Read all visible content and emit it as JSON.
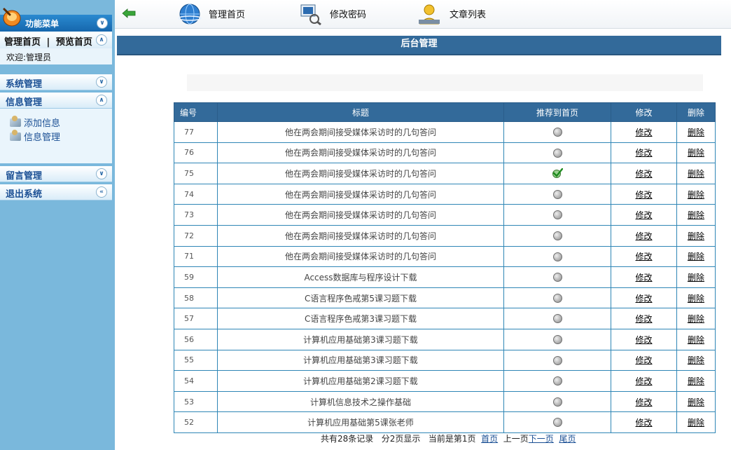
{
  "sidebar": {
    "title": "功能菜单",
    "links": {
      "home": "管理首页",
      "separator": "|",
      "preview": "预览首页"
    },
    "welcome": "欢迎:管理员",
    "sections": [
      {
        "label": "系统管理",
        "state": "collapsed"
      },
      {
        "label": "信息管理",
        "state": "expanded",
        "items": [
          "添加信息",
          "信息管理"
        ]
      },
      {
        "label": "留言管理",
        "state": "collapsed"
      },
      {
        "label": "退出系统",
        "state": "collapsed"
      }
    ]
  },
  "toolbar": {
    "items": [
      "管理首页",
      "修改密码",
      "文章列表"
    ]
  },
  "header": {
    "title": "后台管理"
  },
  "table": {
    "columns": [
      "编号",
      "标题",
      "推荐到首页",
      "修改",
      "删除"
    ],
    "edit_label": "修改",
    "delete_label": "删除",
    "rows": [
      {
        "id": "77",
        "title": "他在两会期间接受媒体采访时的几句答问",
        "recommended": false
      },
      {
        "id": "76",
        "title": "他在两会期间接受媒体采访时的几句答问",
        "recommended": false
      },
      {
        "id": "75",
        "title": "他在两会期间接受媒体采访时的几句答问",
        "recommended": true
      },
      {
        "id": "74",
        "title": "他在两会期间接受媒体采访时的几句答问",
        "recommended": false
      },
      {
        "id": "73",
        "title": "他在两会期间接受媒体采访时的几句答问",
        "recommended": false
      },
      {
        "id": "72",
        "title": "他在两会期间接受媒体采访时的几句答问",
        "recommended": false
      },
      {
        "id": "71",
        "title": "他在两会期间接受媒体采访时的几句答问",
        "recommended": false
      },
      {
        "id": "59",
        "title": "Access数据库与程序设计下载",
        "recommended": false
      },
      {
        "id": "58",
        "title": "C语言程序色戒第5课习题下载",
        "recommended": false
      },
      {
        "id": "57",
        "title": "C语言程序色戒第3课习题下载",
        "recommended": false
      },
      {
        "id": "56",
        "title": "计算机应用基础第3课习题下载",
        "recommended": false
      },
      {
        "id": "55",
        "title": "计算机应用基础第3课习题下载",
        "recommended": false
      },
      {
        "id": "54",
        "title": "计算机应用基础第2课习题下载",
        "recommended": false
      },
      {
        "id": "53",
        "title": "计算机信息技术之操作基础",
        "recommended": false
      },
      {
        "id": "52",
        "title": "计算机应用基础第5课张老师",
        "recommended": false
      }
    ]
  },
  "pager": {
    "total": "共有28条记录",
    "pages": "分2页显示",
    "current": "当前是第1页",
    "first": "首页",
    "prev": "上一页",
    "next": "下一页",
    "last": "尾页"
  },
  "colors": {
    "header_blue": "#336a9a",
    "sidebar_blue": "#7ab8dc",
    "table_border": "#2f86b6"
  }
}
